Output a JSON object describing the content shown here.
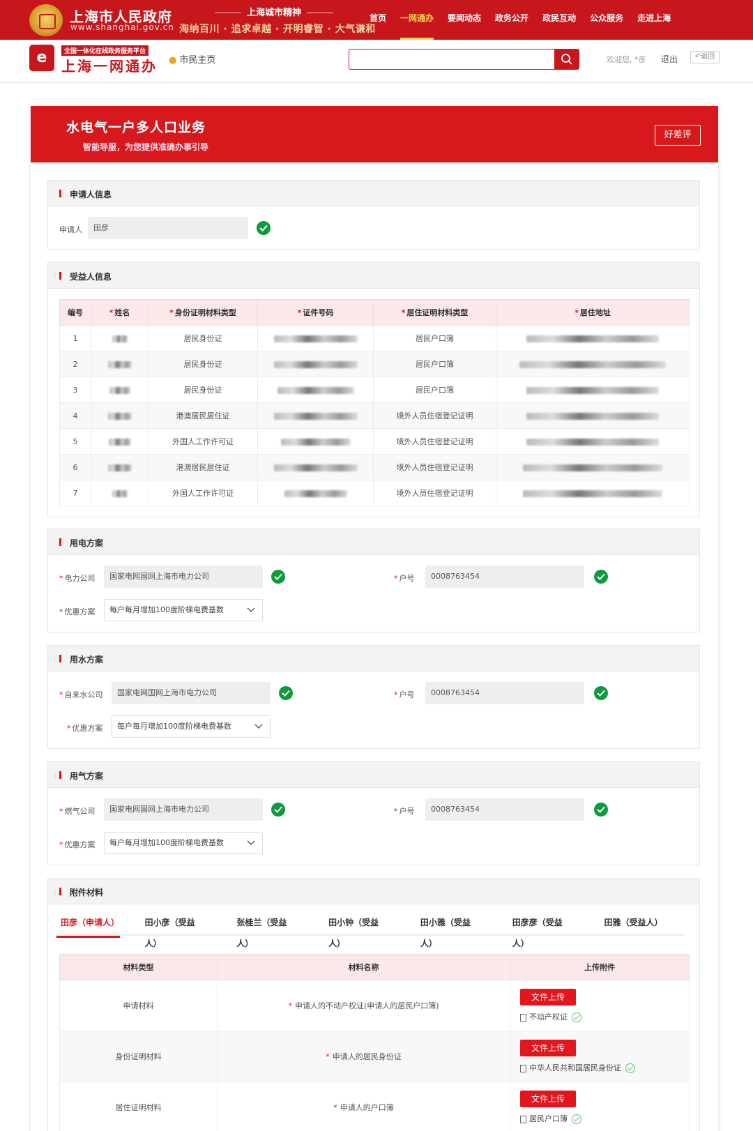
{
  "gov": {
    "title": "上海市人民政府",
    "url": "www.shanghai.gov.cn",
    "slogan_top": "上海城市精神",
    "slogan_bottom": "海纳百川 · 追求卓越 · 开明睿智 · 大气谦和"
  },
  "topnav": [
    "首页",
    "一网通办",
    "要闻动态",
    "政务公开",
    "政民互动",
    "公众服务",
    "走进上海"
  ],
  "topnav_active": "一网通办",
  "yiwang": {
    "tag": "全国一体化在线政务服务平台",
    "name": "上海一网通办",
    "citizen": "市民主页",
    "welcome": "欢迎您, *彦",
    "logout": "退出",
    "back": "返回"
  },
  "search": {
    "placeholder": "",
    "value": ""
  },
  "hero": {
    "title": "水电气一户多人口业务",
    "subtitle": "智能导服，为您提供准确办事引导",
    "rate_button": "好差评"
  },
  "applicant": {
    "section_title": "申请人信息",
    "label": "申请人",
    "value": "田彦"
  },
  "beneficiaries": {
    "section_title": "受益人信息",
    "headers": [
      "编号",
      "姓名",
      "身份证明材料类型",
      "证件号码",
      "居住证明材料类型",
      "居住地址"
    ],
    "required_cols": [
      false,
      true,
      true,
      true,
      true,
      true
    ],
    "rows": [
      [
        "1",
        "居民身份证",
        "居民户口簿"
      ],
      [
        "2",
        "居民身份证",
        "居民户口簿"
      ],
      [
        "3",
        "居民身份证",
        "居民户口簿"
      ],
      [
        "4",
        "港澳居民居住证",
        "境外人员住宿登记证明"
      ],
      [
        "5",
        "外国人工作许可证",
        "境外人员住宿登记证明"
      ],
      [
        "6",
        "港澳居民居住证",
        "境外人员住宿登记证明"
      ],
      [
        "7",
        "外国人工作许可证",
        "境外人员住宿登记证明"
      ]
    ]
  },
  "electric": {
    "section_title": "用电方案",
    "company_label": "电力公司",
    "company_value": "国家电网国网上海市电力公司",
    "account_label": "户号",
    "account_value": "0008763454",
    "plan_label": "优惠方案",
    "plan_value": "每户每月增加100度阶梯电费基数"
  },
  "water": {
    "section_title": "用水方案",
    "company_label": "自来水公司",
    "company_value": "国家电网国网上海市电力公司",
    "account_label": "户号",
    "account_value": "0008763454",
    "plan_label": "优惠方案",
    "plan_value": "每户每月增加100度阶梯电费基数"
  },
  "gas": {
    "section_title": "用气方案",
    "company_label": "燃气公司",
    "company_value": "国家电网国网上海市电力公司",
    "account_label": "户号",
    "account_value": "0008763454",
    "plan_label": "优惠方案",
    "plan_value": "每户每月增加100度阶梯电费基数"
  },
  "attachments": {
    "section_title": "附件材料",
    "tabs": [
      "田彦（申请人）",
      "田小彦（受益人）",
      "张桂兰（受益人）",
      "田小钟（受益人）",
      "田小雅（受益人）",
      "田彦彦（受益人）",
      "田雅（受益人）"
    ],
    "active_tab": 0,
    "headers": [
      "材料类型",
      "材料名称",
      "上传附件"
    ],
    "upload_label": "文件上传",
    "rows": [
      {
        "type": "申请材料",
        "name": "申请人的不动产权证(申请人的居民户口簿)",
        "file": "不动产权证"
      },
      {
        "type": "身份证明材料",
        "name": "申请人的居民身份证",
        "file": "中华人民共和国居民身份证"
      },
      {
        "type": "居住证明材料",
        "name": "申请人的户口簿",
        "file": "居民户口簿"
      }
    ]
  },
  "colors": {
    "brand_red": "#c8161d",
    "accent_yellow": "#ffd54a",
    "success_green": "#0e9a3d"
  }
}
